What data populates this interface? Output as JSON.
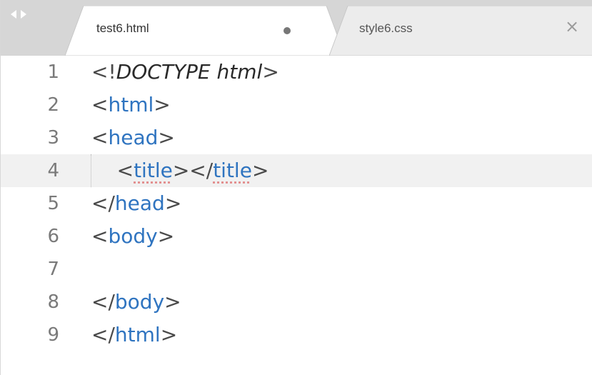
{
  "tabs": [
    {
      "label": "test6.html",
      "active": true,
      "modified": true
    },
    {
      "label": "style6.css",
      "active": false,
      "close_glyph": "×"
    }
  ],
  "nav": {
    "back_icon": "arrow-left-icon",
    "forward_icon": "arrow-right-icon"
  },
  "editor": {
    "current_line": 4,
    "lines": [
      {
        "number": "1",
        "text": "<!DOCTYPE html>"
      },
      {
        "number": "2",
        "text": "<html>"
      },
      {
        "number": "3",
        "text": "<head>"
      },
      {
        "number": "4",
        "text": "    <title></title>"
      },
      {
        "number": "5",
        "text": "</head>"
      },
      {
        "number": "6",
        "text": "<body>"
      },
      {
        "number": "7",
        "text": ""
      },
      {
        "number": "8",
        "text": "</body>"
      },
      {
        "number": "9",
        "text": "</html>"
      }
    ]
  },
  "colors": {
    "tag": "#2f74c0",
    "gutter_text": "#7a7a7a",
    "tab_bar": "#d6d6d6",
    "current_line": "#f1f1f1"
  }
}
